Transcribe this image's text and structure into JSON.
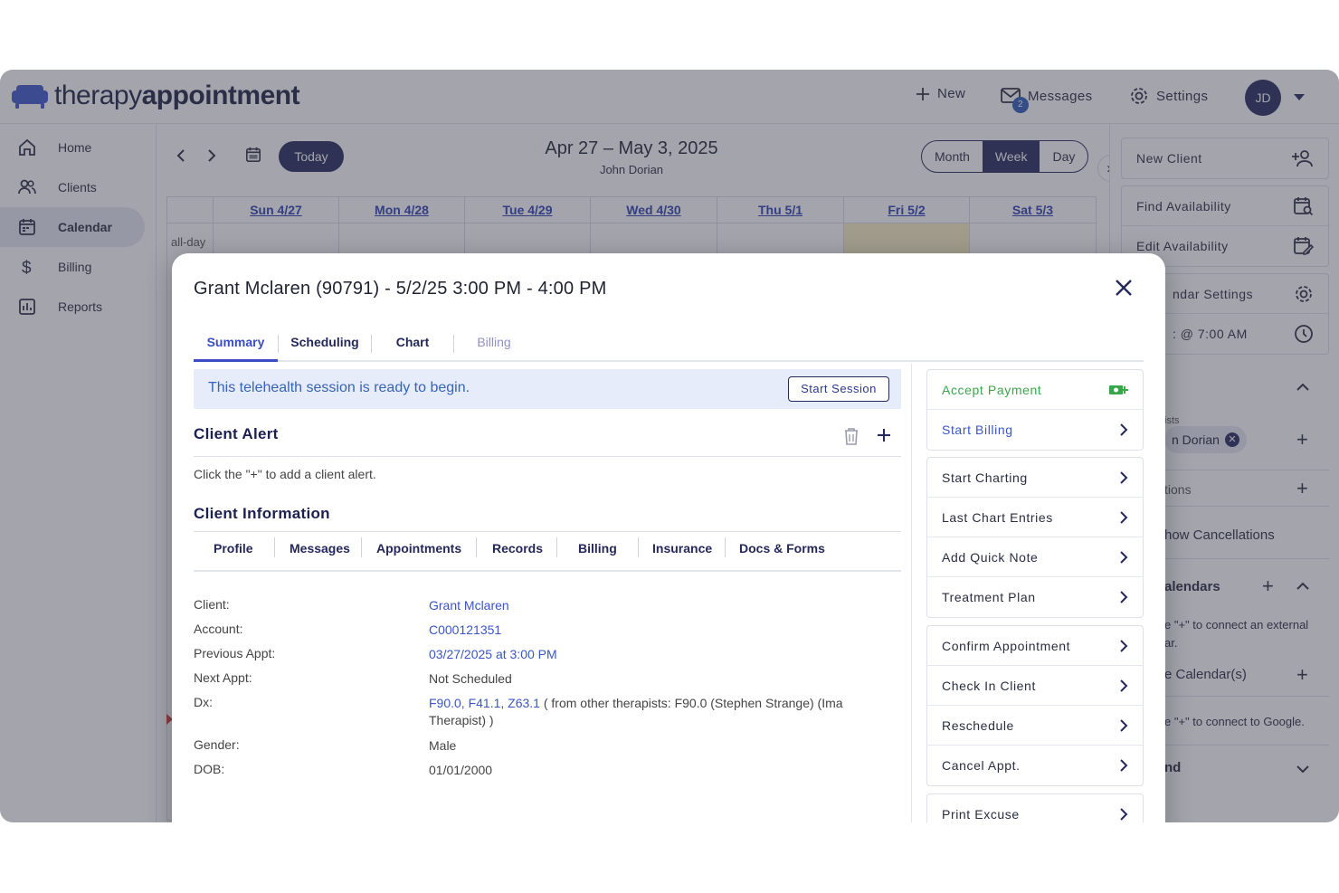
{
  "app": {
    "logo_regular": "therapy",
    "logo_bold": "appointment"
  },
  "topbar": {
    "new_label": "New",
    "messages_label": "Messages",
    "messages_count": "2",
    "settings_label": "Settings",
    "avatar_initials": "JD"
  },
  "sidebar": {
    "items": [
      {
        "label": "Home",
        "icon": "home-icon"
      },
      {
        "label": "Clients",
        "icon": "clients-icon"
      },
      {
        "label": "Calendar",
        "icon": "calendar-icon"
      },
      {
        "label": "Billing",
        "icon": "dollar-icon"
      },
      {
        "label": "Reports",
        "icon": "reports-icon"
      }
    ],
    "active": "Calendar"
  },
  "calendar": {
    "today_label": "Today",
    "range": "Apr 27 – May 3, 2025",
    "user": "John Dorian",
    "views": [
      "Month",
      "Week",
      "Day"
    ],
    "active_view": "Week",
    "days": [
      "Sun 4/27",
      "Mon 4/28",
      "Tue 4/29",
      "Wed 4/30",
      "Thu 5/1",
      "Fri 5/2",
      "Sat 5/3"
    ],
    "allday_label": "all-day"
  },
  "right_panel": {
    "card1": [
      {
        "label": "New Client",
        "icon": "add-user-icon"
      }
    ],
    "card2": [
      {
        "label": "Find Availability",
        "icon": "calendar-search-icon"
      },
      {
        "label": "Edit Availability",
        "icon": "calendar-edit-icon"
      }
    ],
    "card3": [
      {
        "label": "ndar Settings",
        "icon": "gear-icon"
      },
      {
        "label": ": @ 7:00 AM",
        "icon": "clock-icon"
      }
    ],
    "therapists_label": "ists",
    "therapist_chip": "n Dorian",
    "locations_label": "tions",
    "show_cancellations": "how Cancellations",
    "calendars_title": "alendars",
    "calendars_help_1": "e \"+\" to connect an external",
    "calendars_help_2": "ar.",
    "google_label": "e Calendar(s)",
    "google_help": "e \"+\" to connect to Google.",
    "legend_label": "nd"
  },
  "modal": {
    "title": "Grant Mclaren (90791) - 5/2/25 3:00 PM - 4:00 PM",
    "tabs": [
      "Summary",
      "Scheduling",
      "Chart",
      "Billing"
    ],
    "active_tab": "Summary",
    "telehealth_text": "This telehealth session is ready to begin.",
    "start_session_label": "Start Session",
    "client_alert_title": "Client Alert",
    "client_alert_help": "Click the \"+\" to add a client alert.",
    "client_info_title": "Client Information",
    "info_tabs": [
      "Profile",
      "Messages",
      "Appointments",
      "Records",
      "Billing",
      "Insurance",
      "Docs & Forms"
    ],
    "info": {
      "client_label": "Client:",
      "client_value": "Grant Mclaren",
      "account_label": "Account:",
      "account_value": "C000121351",
      "prev_label": "Previous Appt:",
      "prev_value": "03/27/2025 at 3:00 PM",
      "next_label": "Next Appt:",
      "next_value": "Not Scheduled",
      "dx_label": "Dx:",
      "dx_codes": "F90.0, F41.1, Z63.1",
      "dx_note": " ( from other therapists: F90.0 (Stephen Strange) (Ima Therapist) )",
      "gender_label": "Gender:",
      "gender_value": "Male",
      "dob_label": "DOB:",
      "dob_value": "01/01/2000"
    },
    "actions_group1": [
      {
        "label": "Accept Payment",
        "style": "green",
        "icon": "cash-plus-icon"
      },
      {
        "label": "Start Billing",
        "style": "blue",
        "icon": "chevron-right-icon"
      }
    ],
    "actions_group2": [
      {
        "label": "Start Charting"
      },
      {
        "label": "Last Chart Entries"
      },
      {
        "label": "Add Quick Note"
      },
      {
        "label": "Treatment Plan"
      }
    ],
    "actions_group3": [
      {
        "label": "Confirm Appointment"
      },
      {
        "label": "Check In Client"
      },
      {
        "label": "Reschedule"
      },
      {
        "label": "Cancel Appt."
      }
    ],
    "actions_group4": [
      {
        "label": "Print Excuse"
      }
    ]
  },
  "colors": {
    "brand_navy": "#25285a",
    "link_blue": "#3b55c6",
    "accept_green": "#3aa64a",
    "banner_bg": "#e6ecfa"
  }
}
